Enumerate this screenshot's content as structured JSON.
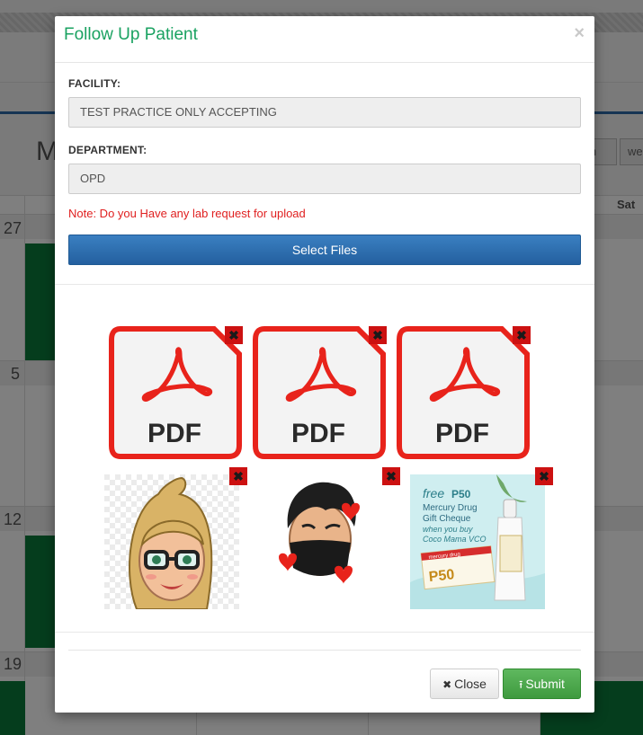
{
  "background": {
    "heading_partial": "M",
    "view_buttons": [
      "nth",
      "we"
    ],
    "day_header": "Sat",
    "day_numbers": [
      "27",
      "5",
      "12",
      "19"
    ]
  },
  "modal": {
    "title": "Follow Up Patient",
    "close_glyph": "×",
    "facility": {
      "label": "FACILITY:",
      "value": "TEST PRACTICE ONLY ACCEPTING"
    },
    "department": {
      "label": "DEPARTMENT:",
      "value": "OPD"
    },
    "note": "Note:  Do you Have any lab request for upload",
    "select_files_label": "Select Files",
    "files": [
      {
        "type": "pdf",
        "label": "PDF",
        "icon": "pdf-file-icon"
      },
      {
        "type": "pdf",
        "label": "PDF",
        "icon": "pdf-file-icon"
      },
      {
        "type": "pdf",
        "label": "PDF",
        "icon": "pdf-file-icon"
      },
      {
        "type": "image",
        "icon": "girl-avatar-image"
      },
      {
        "type": "image",
        "icon": "boy-mask-avatar-image"
      },
      {
        "type": "image",
        "icon": "coupon-ad-image",
        "ad_text": {
          "free": "free",
          "amount": "P50",
          "line1": "Mercury Drug",
          "line2": "Gift Cheque",
          "line3": "when you buy",
          "line4": "Coco Mama VCO",
          "cheque_amount": "P50",
          "brand": "mercury drug"
        }
      }
    ],
    "remove_glyph": "✖",
    "footer": {
      "close_icon": "✖",
      "close_label": "Close",
      "submit_icon": "⭱",
      "submit_label": "Submit"
    }
  },
  "colors": {
    "title_green": "#1aa261",
    "note_red": "#e02020",
    "pdf_red": "#e8231b",
    "select_blue": "#2e70b1",
    "submit_green": "#4cae4c"
  }
}
